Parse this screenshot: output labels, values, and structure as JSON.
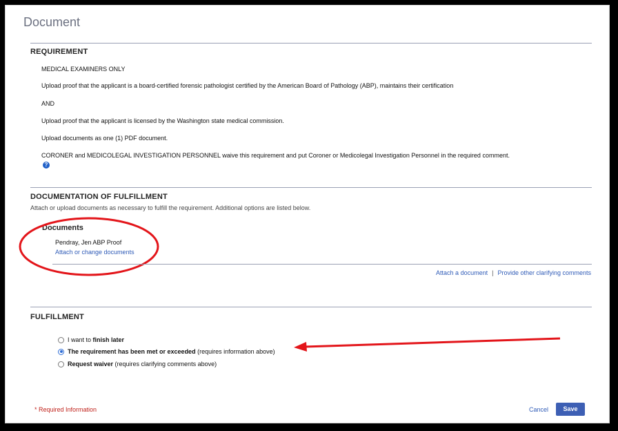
{
  "page": {
    "title": "Document"
  },
  "requirement": {
    "heading": "REQUIREMENT",
    "lines": [
      "MEDICAL EXAMINERS ONLY",
      "Upload proof that the applicant is a board-certified forensic pathologist certified by the American Board of Pathology (ABP), maintains their certification",
      "AND",
      "Upload proof that the applicant is licensed by the Washington state medical commission.",
      "Upload documents as one (1) PDF document.",
      "CORONER and MEDICOLEGAL INVESTIGATION PERSONNEL waive this requirement and put Coroner or Medicolegal Investigation Personnel in the required comment."
    ],
    "help_glyph": "?"
  },
  "documentation": {
    "heading": "DOCUMENTATION OF FULFILLMENT",
    "subtext": "Attach or upload documents as necessary to fulfill the requirement. Additional options are listed below.",
    "documents_heading": "Documents",
    "document_name": "Pendray, Jen ABP Proof",
    "attach_change_link": "Attach or change documents",
    "attach_link": "Attach a document",
    "separator": "|",
    "clarify_link": "Provide other clarifying comments"
  },
  "fulfillment": {
    "heading": "FULFILLMENT",
    "options": [
      {
        "prefix": "I want to ",
        "bold": "finish later",
        "suffix": "",
        "checked": false
      },
      {
        "prefix": "",
        "bold": "The requirement has been met or exceeded",
        "suffix": " (requires information above)",
        "checked": true
      },
      {
        "prefix": "",
        "bold": "Request waiver",
        "suffix": " (requires clarifying comments above)",
        "checked": false
      }
    ]
  },
  "footer": {
    "required_info": "* Required Information",
    "cancel_label": "Cancel",
    "save_label": "Save"
  },
  "colors": {
    "annotation": "#e3151a",
    "accent": "#3d5fb4",
    "link": "#2f5bb7"
  }
}
